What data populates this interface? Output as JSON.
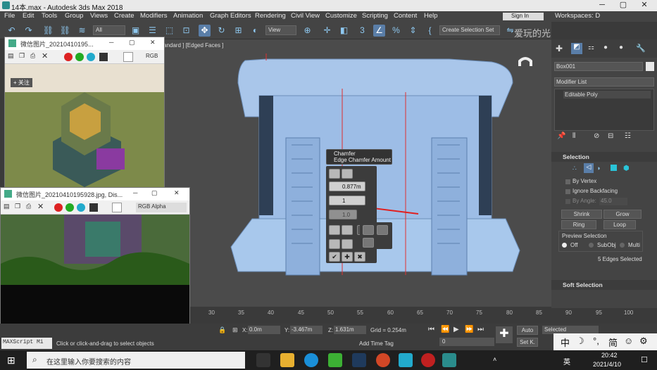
{
  "window": {
    "title": "14本.max - Autodesk 3ds Max 2018",
    "min": "─",
    "max": "▢",
    "close": "✕"
  },
  "menu": [
    "File",
    "Edit",
    "Tools",
    "Group",
    "Views",
    "Create",
    "Modifiers",
    "Animation",
    "Graph Editors",
    "Rendering",
    "Civil View",
    "Customize",
    "Scripting",
    "Content",
    "Help"
  ],
  "signin": "Sign In",
  "workspaces": "Workspaces: D",
  "toolbar": {
    "filter": "All",
    "view": "View",
    "snap": "3",
    "selection_set": "Create Selection Set"
  },
  "watermark": "爱玩的光腕君",
  "viewport": {
    "label": "andard ] [Edged Faces ]"
  },
  "caddy": {
    "title": "Chamfer",
    "subtitle": "Edge Chamfer Amount",
    "amount": "0.877m",
    "segments": "1",
    "tension": "1.0"
  },
  "img1": {
    "title": "微信图片_20210410195...",
    "channel": "RGB",
    "follow": "+ 关注"
  },
  "img2": {
    "title": "微信图片_20210410195928.jpg, Dis...",
    "channel": "RGB Alpha"
  },
  "cmd": {
    "object_name": "Box001",
    "modifier_list": "Modifier List",
    "stack_item": "Editable Poly",
    "selection_head": "Selection",
    "by_vertex": "By Vertex",
    "ignore_backfacing": "Ignore Backfacing",
    "by_angle": "By Angle:",
    "angle": "45.0",
    "shrink": "Shrink",
    "grow": "Grow",
    "ring": "Ring",
    "loop": "Loop",
    "preview": "Preview Selection",
    "off": "Off",
    "subobj": "SubObj",
    "multi": "Multi",
    "selected": "5 Edges Selected",
    "soft_head": "Soft Selection"
  },
  "timeline": {
    "ticks": [
      "30",
      "35",
      "40",
      "45",
      "50",
      "55",
      "60",
      "65",
      "70",
      "75",
      "80",
      "85",
      "90",
      "95",
      "100"
    ]
  },
  "status": {
    "maxscript": "MAXScript Mi",
    "prompt": "Click or click-and-drag to select objects",
    "x": "0.0m",
    "y": "-3.467m",
    "z": "1.631m",
    "grid": "Grid = 0.254m",
    "addtime": "Add Time Tag",
    "auto": "Auto",
    "setk": "Set K.",
    "selected": "Selected",
    "frame": "0"
  },
  "taskbar": {
    "search": "在这里输入你要搜索的内容",
    "lang": "英",
    "time": "20:42",
    "date": "2021/4/10"
  },
  "colors": {
    "accent": "#5aa0d8",
    "mesh": "#a8c8ec",
    "caddy": "#3c3c3c"
  }
}
